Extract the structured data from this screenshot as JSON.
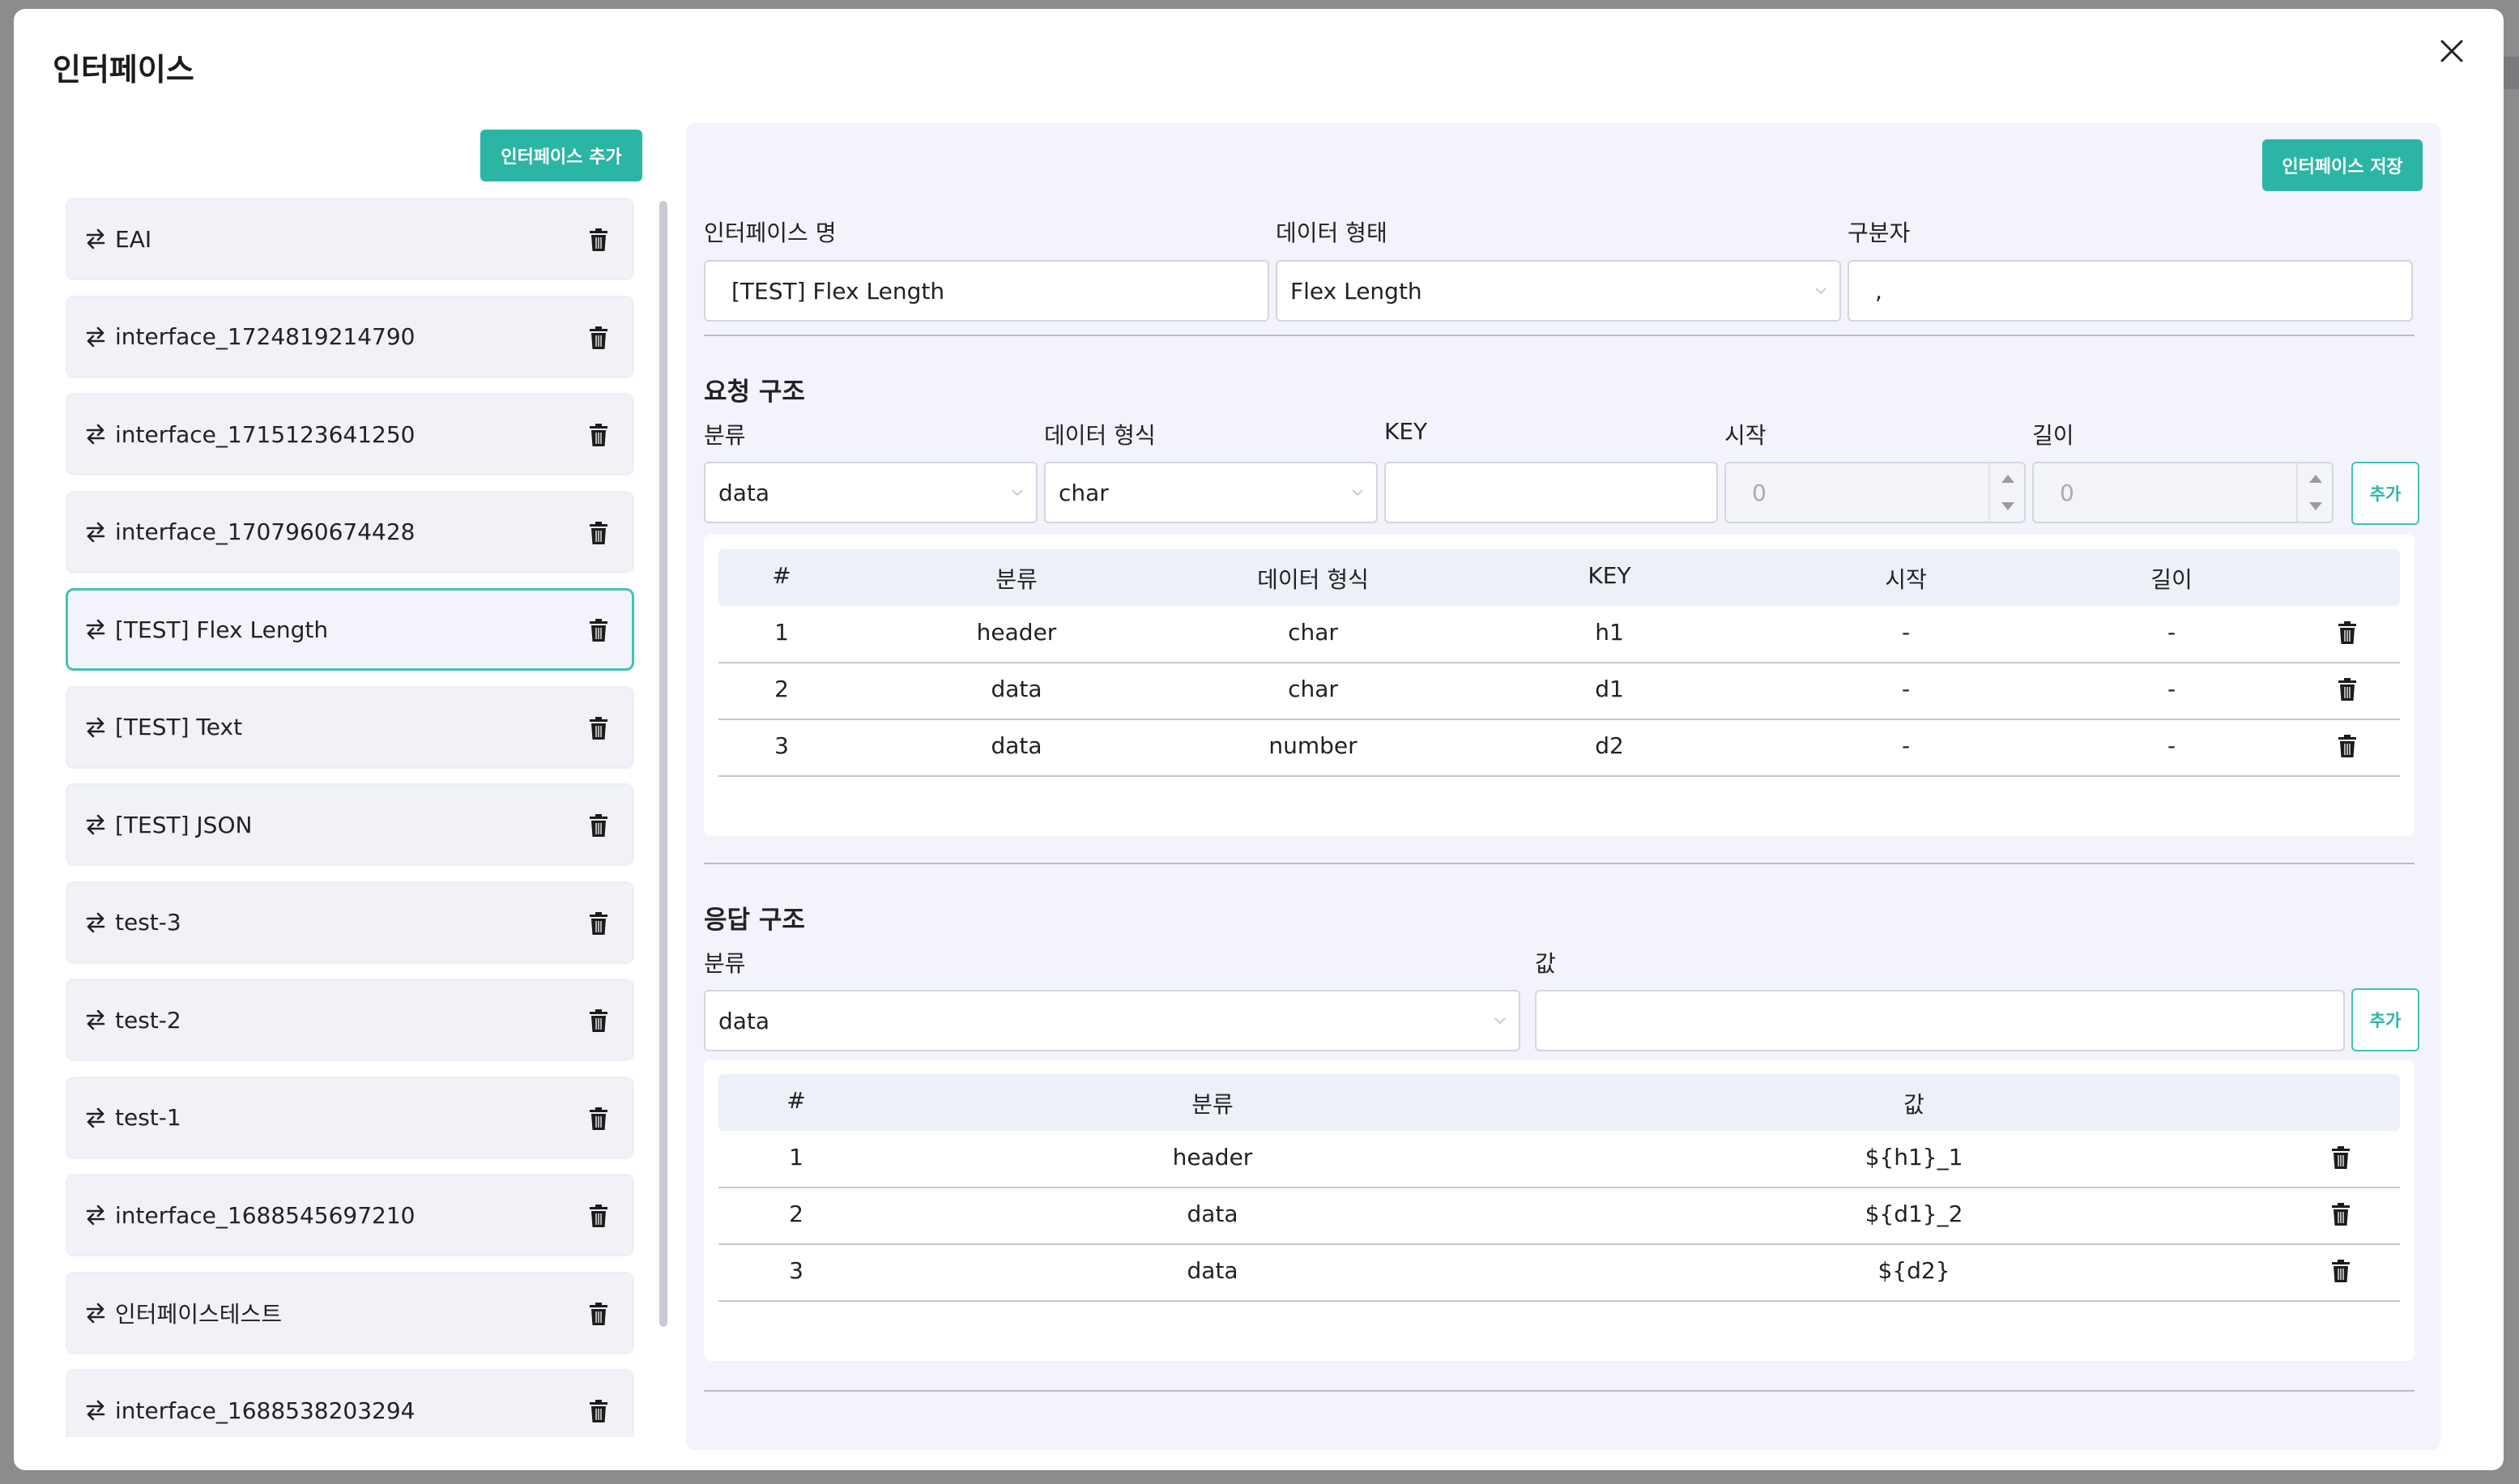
{
  "modal": {
    "title": "인터페이스"
  },
  "left": {
    "add_button": "인터페이스 추가",
    "items": [
      {
        "label": "EAI"
      },
      {
        "label": "interface_1724819214790"
      },
      {
        "label": "interface_1715123641250"
      },
      {
        "label": "interface_1707960674428"
      },
      {
        "label": "[TEST] Flex Length",
        "selected": true
      },
      {
        "label": "[TEST] Text"
      },
      {
        "label": "[TEST] JSON"
      },
      {
        "label": "test-3"
      },
      {
        "label": "test-2"
      },
      {
        "label": "test-1"
      },
      {
        "label": "interface_1688545697210"
      },
      {
        "label": "인터페이스테스트"
      },
      {
        "label": "interface_1688538203294"
      }
    ]
  },
  "right": {
    "save_button": "인터페이스 저장",
    "fields": {
      "name_label": "인터페이스 명",
      "name_value": "[TEST] Flex Length",
      "type_label": "데이터 형태",
      "type_value": "Flex Length",
      "sep_label": "구분자",
      "sep_value": ","
    },
    "request": {
      "title": "요청 구조",
      "category_label": "분류",
      "category_value": "data",
      "format_label": "데이터 형식",
      "format_value": "char",
      "key_label": "KEY",
      "key_value": "",
      "start_label": "시작",
      "start_placeholder": "0",
      "length_label": "길이",
      "length_placeholder": "0",
      "add_button": "추가",
      "headers": [
        "#",
        "분류",
        "데이터 형식",
        "KEY",
        "시작",
        "길이"
      ],
      "rows": [
        {
          "no": "1",
          "category": "header",
          "format": "char",
          "key": "h1",
          "start": "-",
          "length": "-"
        },
        {
          "no": "2",
          "category": "data",
          "format": "char",
          "key": "d1",
          "start": "-",
          "length": "-"
        },
        {
          "no": "3",
          "category": "data",
          "format": "number",
          "key": "d2",
          "start": "-",
          "length": "-"
        }
      ]
    },
    "response": {
      "title": "응답 구조",
      "category_label": "분류",
      "category_value": "data",
      "value_label": "값",
      "value_value": "",
      "add_button": "추가",
      "headers": [
        "#",
        "분류",
        "값"
      ],
      "rows": [
        {
          "no": "1",
          "category": "header",
          "value": "${h1}_1"
        },
        {
          "no": "2",
          "category": "data",
          "value": "${d1}_2"
        },
        {
          "no": "3",
          "category": "data",
          "value": "${d2}"
        }
      ]
    }
  },
  "colors": {
    "accent": "#2bb5a5",
    "panel_bg": "#f3f4fb",
    "selected_border": "#40c4b4"
  },
  "icons": {
    "item": "swap-arrows-icon",
    "delete": "trash-icon",
    "close": "close-icon"
  }
}
